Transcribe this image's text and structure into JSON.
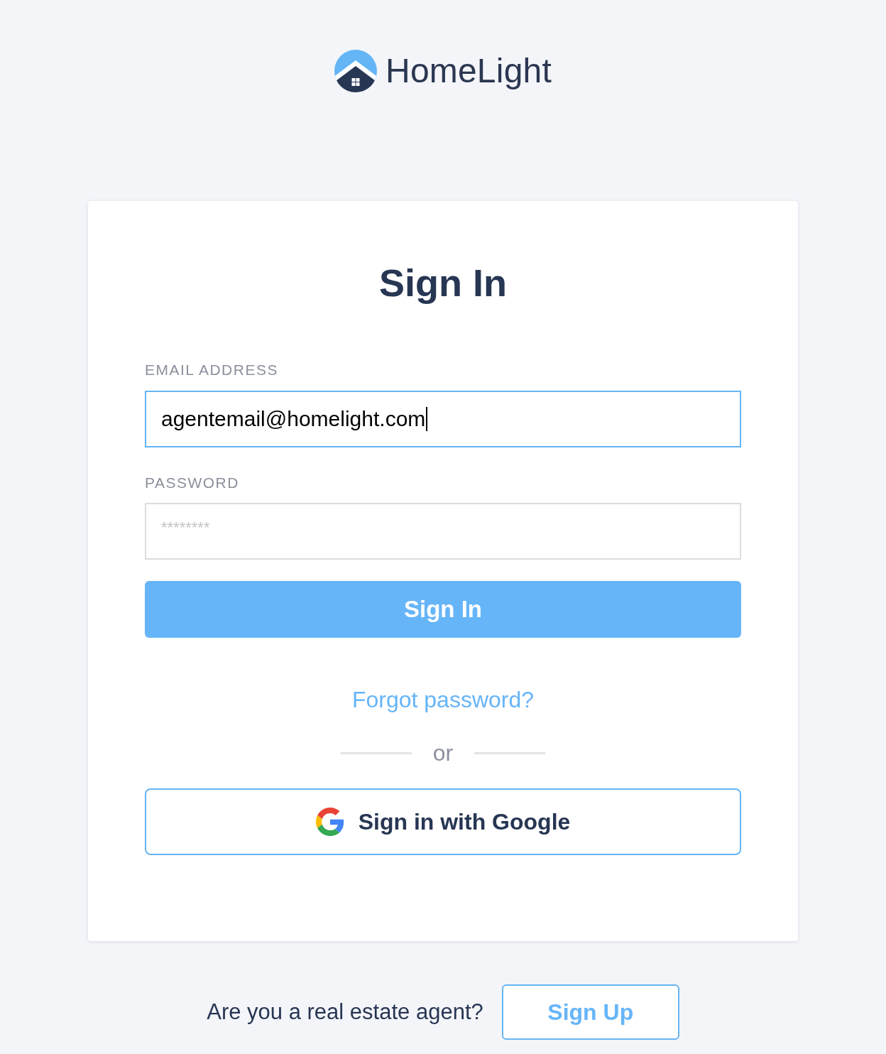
{
  "logo": {
    "text": "HomeLight"
  },
  "card": {
    "title": "Sign In",
    "fields": [
      {
        "label": "EMAIL ADDRESS",
        "value": "agentemail@homelight.com",
        "focused": true
      },
      {
        "label": "PASSWORD",
        "placeholder": "********",
        "focused": false
      }
    ],
    "submit_button": "Sign In",
    "forgot_link": "Forgot password?",
    "divider": "or",
    "google_button": "Sign in with Google"
  },
  "footer": {
    "prompt": "Are you a real estate agent?",
    "signup_button": "Sign Up"
  }
}
